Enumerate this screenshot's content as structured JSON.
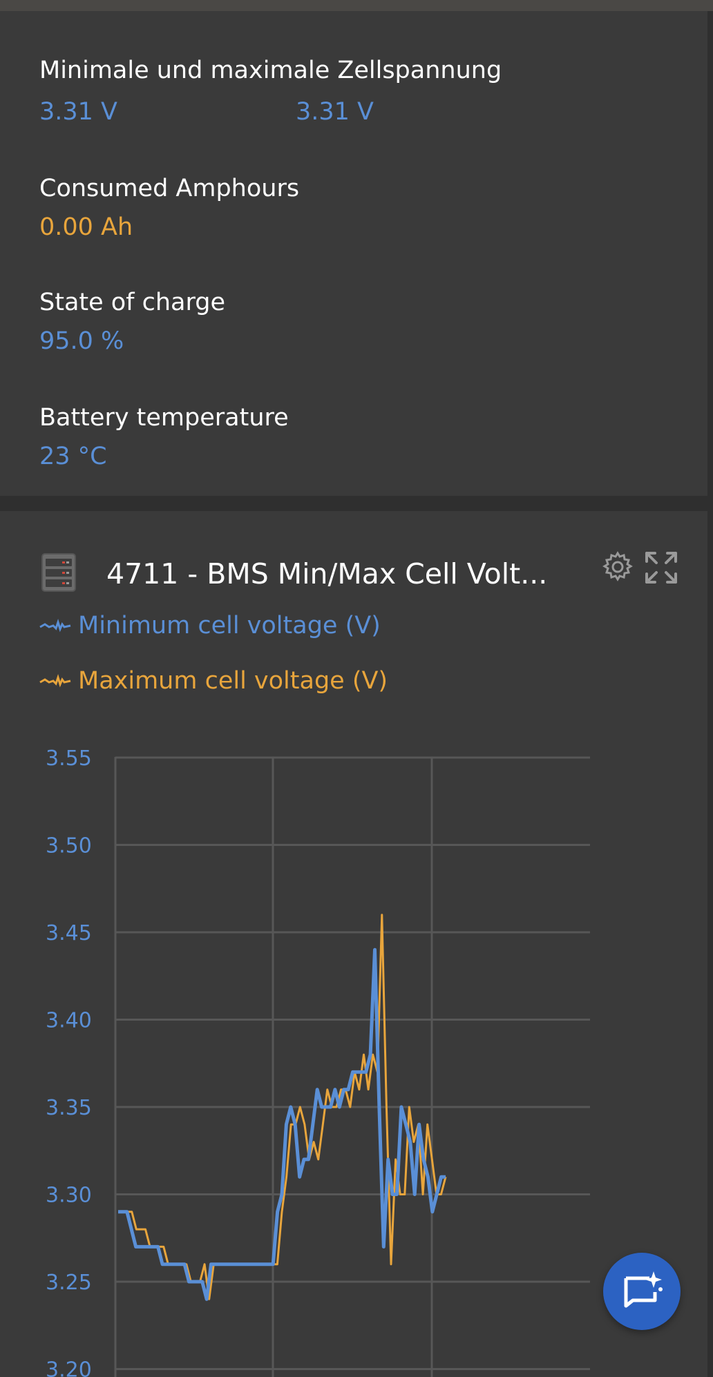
{
  "metrics": {
    "cell_voltage": {
      "label": "Minimale und maximale Zellspannung",
      "min_value": "3.31 V",
      "max_value": "3.31 V"
    },
    "consumed_ah": {
      "label": "Consumed Amphours",
      "value": "0.00 Ah"
    },
    "soc": {
      "label": "State of charge",
      "value": "95.0 %"
    },
    "temperature": {
      "label": "Battery temperature",
      "value": "23 °C"
    }
  },
  "widget": {
    "title": "4711 - BMS Min/Max Cell Volt...",
    "icons": {
      "device": "battery-rack-icon",
      "settings": "gear-icon",
      "expand": "expand-icon",
      "fab": "chat-sparkle-icon"
    },
    "legend": [
      {
        "label": "Minimum cell voltage (V)",
        "color": "#5a8fd6"
      },
      {
        "label": "Maximum cell voltage (V)",
        "color": "#e8a53c"
      }
    ]
  },
  "chart_data": {
    "type": "line",
    "y_ticks": [
      "3.55",
      "3.50",
      "3.45",
      "3.40",
      "3.35",
      "3.30",
      "3.25",
      "3.20"
    ],
    "ylim": [
      3.2,
      3.55
    ],
    "grid": true,
    "series": [
      {
        "name": "Maximum cell voltage (V)",
        "color": "#e8a53c",
        "values": [
          3.29,
          3.29,
          3.29,
          3.29,
          3.28,
          3.28,
          3.28,
          3.27,
          3.27,
          3.27,
          3.27,
          3.26,
          3.26,
          3.26,
          3.26,
          3.26,
          3.25,
          3.25,
          3.25,
          3.26,
          3.24,
          3.26,
          3.26,
          3.26,
          3.26,
          3.26,
          3.26,
          3.26,
          3.26,
          3.26,
          3.26,
          3.26,
          3.26,
          3.26,
          3.26,
          3.26,
          3.29,
          3.31,
          3.34,
          3.34,
          3.35,
          3.34,
          3.32,
          3.33,
          3.32,
          3.34,
          3.36,
          3.35,
          3.35,
          3.36,
          3.36,
          3.35,
          3.37,
          3.36,
          3.38,
          3.36,
          3.38,
          3.37,
          3.46,
          3.35,
          3.26,
          3.32,
          3.3,
          3.3,
          3.35,
          3.33,
          3.34,
          3.3,
          3.34,
          3.32,
          3.3,
          3.3,
          3.31
        ]
      },
      {
        "name": "Minimum cell voltage (V)",
        "color": "#5a8fd6",
        "values": [
          3.29,
          3.29,
          3.29,
          3.28,
          3.27,
          3.27,
          3.27,
          3.27,
          3.27,
          3.27,
          3.26,
          3.26,
          3.26,
          3.26,
          3.26,
          3.26,
          3.25,
          3.25,
          3.25,
          3.25,
          3.24,
          3.26,
          3.26,
          3.26,
          3.26,
          3.26,
          3.26,
          3.26,
          3.26,
          3.26,
          3.26,
          3.26,
          3.26,
          3.26,
          3.26,
          3.26,
          3.29,
          3.3,
          3.34,
          3.35,
          3.34,
          3.31,
          3.32,
          3.32,
          3.34,
          3.36,
          3.35,
          3.35,
          3.35,
          3.36,
          3.35,
          3.36,
          3.36,
          3.37,
          3.37,
          3.37,
          3.37,
          3.38,
          3.44,
          3.35,
          3.27,
          3.32,
          3.3,
          3.3,
          3.35,
          3.34,
          3.33,
          3.3,
          3.34,
          3.32,
          3.31,
          3.29,
          3.3,
          3.31,
          3.31
        ]
      }
    ]
  }
}
